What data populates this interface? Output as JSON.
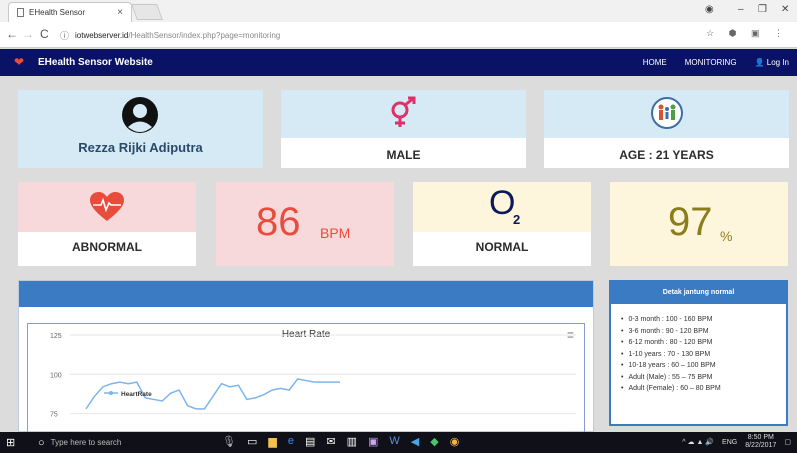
{
  "browser": {
    "tab_title": "EHealth Sensor",
    "url_host": "iotwebserver.id",
    "url_path": "/HealthSensor/index.php?page=monitoring"
  },
  "site": {
    "brand": "EHealth Sensor Website",
    "nav": {
      "home": "HOME",
      "monitoring": "MONITORING",
      "login": "Log In"
    }
  },
  "profile": {
    "name": "Rezza Rijki Adiputra",
    "gender": "MALE",
    "age": "AGE : 21 YEARS"
  },
  "vitals": {
    "heart_status": "ABNORMAL",
    "bpm_value": "86",
    "bpm_unit": "BPM",
    "o2_symbol": "O",
    "o2_sub": "2",
    "o2_status": "NORMAL",
    "spo2_value": "97",
    "spo2_unit": "%"
  },
  "chart": {
    "title": "Heart Rate",
    "legend": "HeartRate",
    "y_ticks": [
      "125",
      "100",
      "75"
    ]
  },
  "chart_data": {
    "type": "line",
    "title": "Heart Rate",
    "ylim": [
      62,
      132
    ],
    "series": [
      {
        "name": "HeartRate",
        "values": [
          78,
          86,
          92,
          94,
          95,
          94,
          95,
          85,
          84,
          83,
          88,
          90,
          80,
          78,
          78,
          86,
          94,
          92,
          93,
          84,
          85,
          87,
          90,
          91,
          90,
          97,
          96,
          95,
          95,
          95,
          95
        ]
      }
    ]
  },
  "normal_ranges": {
    "title": "Detak jantung normal",
    "items": [
      "0-3 month  : 100 - 160 BPM",
      "3-6 month  : 90 - 120 BPM",
      "6-12 month : 80 - 120 BPM",
      "1-10 years  : 70 - 130 BPM",
      "10-18 years : 60 – 100 BPM",
      "Adult (Male) : 55 – 75 BPM",
      "Adult (Female) : 60 – 80 BPM"
    ]
  },
  "taskbar": {
    "search_placeholder": "Type here to search",
    "time": "8:50 PM",
    "date": "8/22/2017",
    "lang": "ENG"
  },
  "colors": {
    "navbar": "#0a1265",
    "accent_blue": "#3b7bc3",
    "heart_red": "#e74c3c",
    "gender_pink": "#e0306a"
  }
}
